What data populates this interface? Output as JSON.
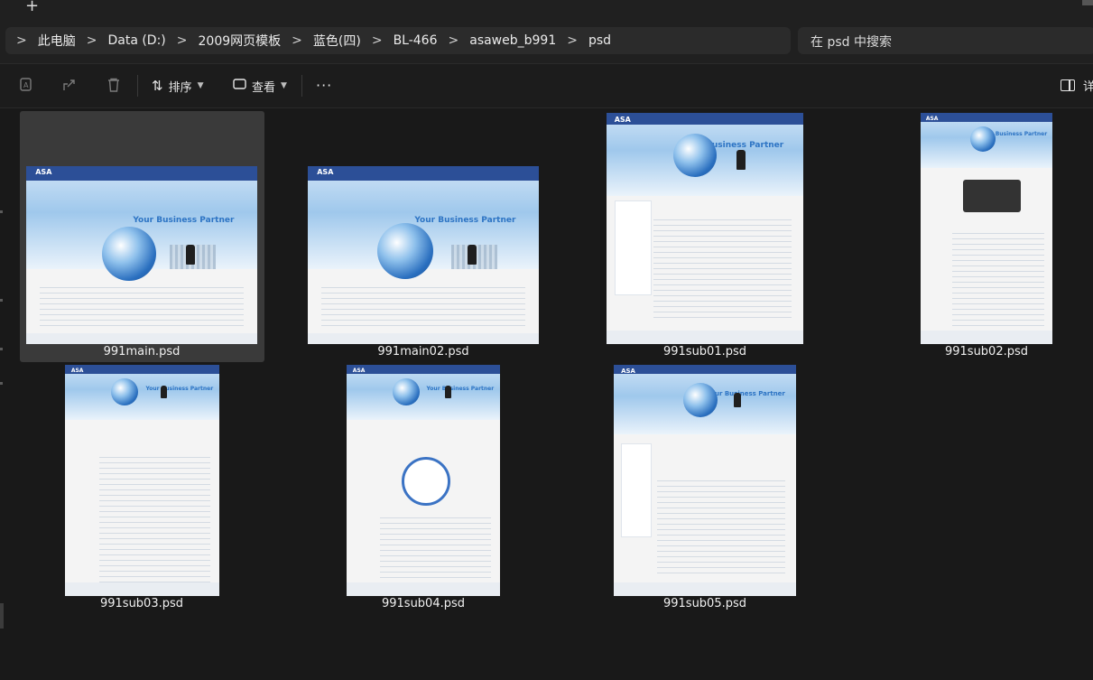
{
  "titlebar": {
    "new_tab_glyph": "+"
  },
  "breadcrumb": {
    "items": [
      "此电脑",
      "Data (D:)",
      "2009网页模板",
      "蓝色(四)",
      "BL-466",
      "asaweb_b991",
      "psd"
    ],
    "separator": ">"
  },
  "search": {
    "placeholder": "在 psd 中搜索"
  },
  "toolbar": {
    "sort_label": "排序",
    "view_label": "查看",
    "more_label": "···",
    "details_label": "详"
  },
  "files": [
    {
      "name": "991main.psd",
      "selected": true,
      "thumb_text": "Your Business Partner"
    },
    {
      "name": "991main02.psd",
      "selected": false,
      "thumb_text": "Your Business Partner"
    },
    {
      "name": "991sub01.psd",
      "selected": false,
      "thumb_text": "Your Business Partner"
    },
    {
      "name": "991sub02.psd",
      "selected": false,
      "thumb_text": "Your Business Partner"
    },
    {
      "name": "991sub03.psd",
      "selected": false,
      "thumb_text": "Your Business Partner"
    },
    {
      "name": "991sub04.psd",
      "selected": false,
      "thumb_text": "Your Business Partner"
    },
    {
      "name": "991sub05.psd",
      "selected": false,
      "thumb_text": "Your Business Partner"
    }
  ],
  "colors": {
    "background": "#191919",
    "toolbar": "#1c1c1c",
    "selection": "#3a3a3a",
    "thumb_blue": "#2c4f97"
  },
  "icons": [
    "translate-icon",
    "share-icon",
    "delete-icon",
    "sort-icon",
    "view-icon",
    "more-icon",
    "details-pane-icon",
    "chevron-right-icon"
  ]
}
